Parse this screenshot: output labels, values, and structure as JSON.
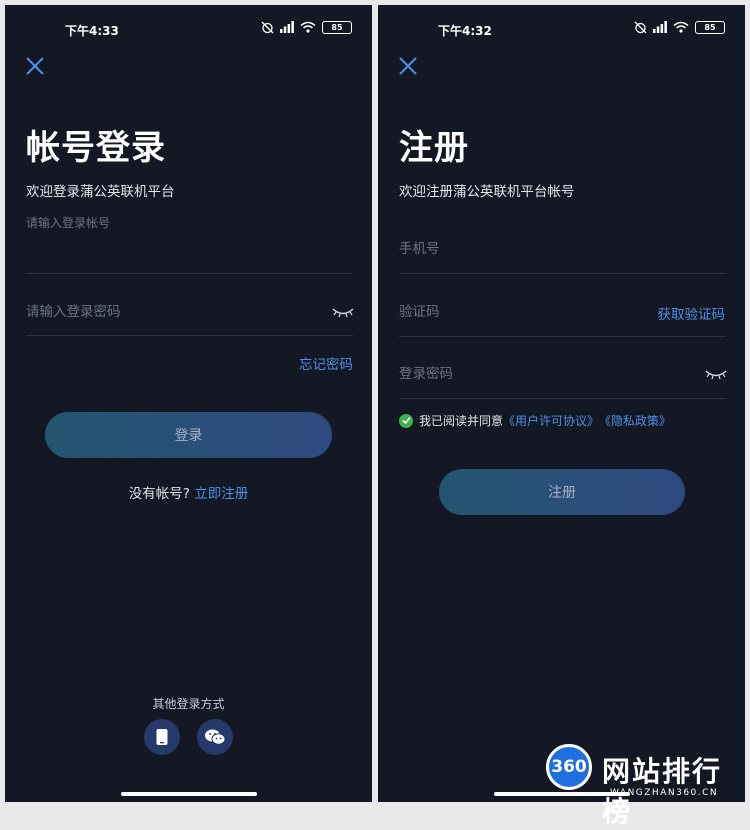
{
  "login_screen": {
    "status": {
      "time": "下午4:33",
      "battery": "85"
    },
    "title": "帐号登录",
    "subtitle": "欢迎登录蒲公英联机平台",
    "account_label": "请输入登录帐号",
    "account_value": "",
    "password_placeholder": "请输入登录密码",
    "forgot_password": "忘记密码",
    "login_button": "登录",
    "no_account": "没有帐号?",
    "register_now": "立即注册",
    "other_methods": "其他登录方式"
  },
  "register_screen": {
    "status": {
      "time": "下午4:32",
      "battery": "85"
    },
    "title": "注册",
    "subtitle": "欢迎注册蒲公英联机平台帐号",
    "phone_placeholder": "手机号",
    "code_placeholder": "验证码",
    "get_code": "获取验证码",
    "password_placeholder": "登录密码",
    "agree_prefix": "我已阅读并同意",
    "user_agreement": "《用户许可协议》",
    "privacy_policy": "《隐私政策》",
    "register_button": "注册"
  },
  "watermark": {
    "logo_text": "360",
    "brand": "网站排行榜",
    "url": "WANGZHAN360.CN"
  },
  "colors": {
    "background": "#141824",
    "accent_link": "#4f8fe6",
    "button_gradient_start": "#245671",
    "button_gradient_end": "#2f4a80",
    "check_green": "#3db34c"
  }
}
